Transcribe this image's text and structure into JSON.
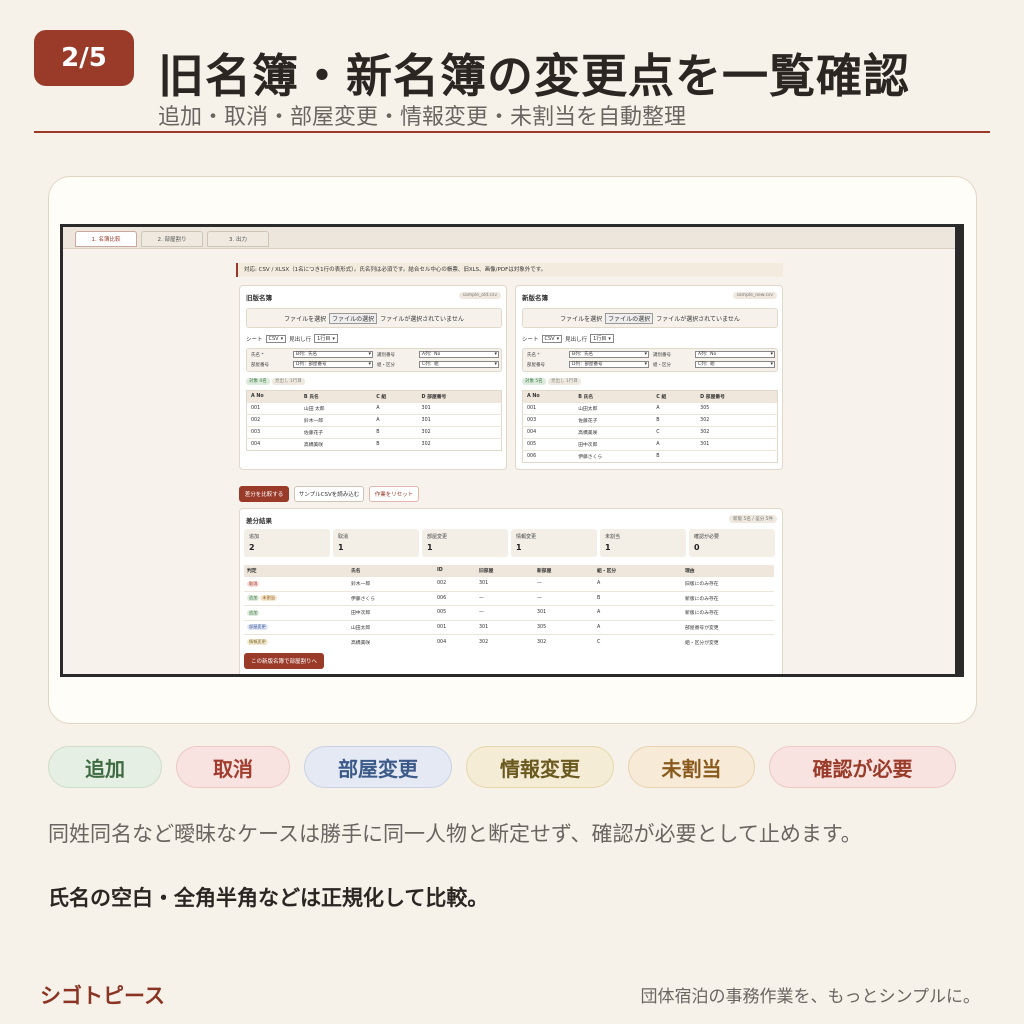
{
  "header": {
    "badge": "2/5",
    "title": "旧名簿・新名簿の変更点を一覧確認",
    "subtitle": "追加・取消・部屋変更・情報変更・未割当を自動整理"
  },
  "app": {
    "tabs": [
      {
        "label": "1. 名簿比較",
        "active": true
      },
      {
        "label": "2. 部屋割り",
        "active": false
      },
      {
        "label": "3. 出力",
        "active": false
      }
    ],
    "notice": "対応: CSV / XLSX（1名につき1行の表形式）。氏名列は必須です。結合セル中心の帳票、旧XLS、画像/PDFは対象外です。",
    "old_roster": {
      "title": "旧版名簿",
      "file_pill": "sample_old.csv",
      "drop_text": "ファイルを選択",
      "file_button": "ファイルの選択",
      "file_status": "ファイルが選択されていません",
      "sheet_label": "シート",
      "sheet_value": "CSV",
      "header_row_label": "見出し行",
      "header_row_value": "1行目",
      "map": {
        "name_label": "氏名 *",
        "name_value": "B列：氏名",
        "id_label": "識別番号",
        "id_value": "A列：No",
        "room_label": "部屋番号",
        "room_value": "D列：部屋番号",
        "class_label": "組・区分",
        "class_value": "C列：組"
      },
      "tag_count": "対象 4名",
      "tag_skip": "見出し 1行目",
      "columns": [
        "A No",
        "B 氏名",
        "C 組",
        "D 部屋番号"
      ],
      "rows": [
        [
          "001",
          "山田 太郎",
          "A",
          "301"
        ],
        [
          "002",
          "鈴木一郎",
          "A",
          "301"
        ],
        [
          "003",
          "佐藤花子",
          "B",
          "302"
        ],
        [
          "004",
          "高橋美咲",
          "B",
          "302"
        ]
      ]
    },
    "new_roster": {
      "title": "新版名簿",
      "file_pill": "sample_new.csv",
      "drop_text": "ファイルを選択",
      "file_button": "ファイルの選択",
      "file_status": "ファイルが選択されていません",
      "sheet_label": "シート",
      "sheet_value": "CSV",
      "header_row_label": "見出し行",
      "header_row_value": "1行目",
      "map": {
        "name_label": "氏名 *",
        "name_value": "B列：氏名",
        "id_label": "識別番号",
        "id_value": "A列：No",
        "room_label": "部屋番号",
        "room_value": "D列：部屋番号",
        "class_label": "組・区分",
        "class_value": "C列：組"
      },
      "tag_count": "対象 5名",
      "tag_skip": "見出し 1行目",
      "columns": [
        "A No",
        "B 氏名",
        "C 組",
        "D 部屋番号"
      ],
      "rows": [
        [
          "001",
          "山田太郎",
          "A",
          "305"
        ],
        [
          "003",
          "佐藤花子",
          "B",
          "302"
        ],
        [
          "004",
          "高橋美咲",
          "C",
          "302"
        ],
        [
          "005",
          "田中次郎",
          "A",
          "301"
        ],
        [
          "006",
          "伊藤さくら",
          "B",
          ""
        ]
      ]
    },
    "buttons": {
      "compare": "差分を比較する",
      "load_sample": "サンプルCSVを読み込む",
      "reset": "作業をリセット",
      "to_rooms": "この新版名簿で部屋割りへ"
    },
    "diff": {
      "title": "差分結果",
      "summary_pill": "新版 5名 / 差分 5件",
      "stats": [
        {
          "label": "追加",
          "value": "2"
        },
        {
          "label": "取消",
          "value": "1"
        },
        {
          "label": "部屋変更",
          "value": "1"
        },
        {
          "label": "情報変更",
          "value": "1"
        },
        {
          "label": "未割当",
          "value": "1"
        },
        {
          "label": "確認が必要",
          "value": "0"
        }
      ],
      "columns": [
        "判定",
        "氏名",
        "ID",
        "旧部屋",
        "新部屋",
        "組・区分",
        "理由"
      ],
      "rows": [
        {
          "labels": [
            {
              "text": "取消",
              "kind": "cancel"
            }
          ],
          "name": "鈴木一郎",
          "id": "002",
          "old": "301",
          "new": "—",
          "class": "A",
          "reason": "旧版にのみ存在"
        },
        {
          "labels": [
            {
              "text": "追加",
              "kind": "add"
            },
            {
              "text": "未割当",
              "kind": "unassigned"
            }
          ],
          "name": "伊藤さくら",
          "id": "006",
          "old": "—",
          "new": "—",
          "class": "B",
          "reason": "新版にのみ存在"
        },
        {
          "labels": [
            {
              "text": "追加",
              "kind": "add"
            }
          ],
          "name": "田中次郎",
          "id": "005",
          "old": "—",
          "new": "301",
          "class": "A",
          "reason": "新版にのみ存在"
        },
        {
          "labels": [
            {
              "text": "部屋変更",
              "kind": "room"
            }
          ],
          "name": "山田太郎",
          "id": "001",
          "old": "301",
          "new": "305",
          "class": "A",
          "reason": "部屋番号が変更"
        },
        {
          "labels": [
            {
              "text": "情報変更",
              "kind": "info"
            }
          ],
          "name": "高橋美咲",
          "id": "004",
          "old": "302",
          "new": "302",
          "class": "C",
          "reason": "組・区分が変更"
        }
      ]
    }
  },
  "chips": [
    {
      "label": "追加",
      "kind": "add"
    },
    {
      "label": "取消",
      "kind": "cancel"
    },
    {
      "label": "部屋変更",
      "kind": "room"
    },
    {
      "label": "情報変更",
      "kind": "info"
    },
    {
      "label": "未割当",
      "kind": "unassigned"
    },
    {
      "label": "確認が必要",
      "kind": "confirm"
    }
  ],
  "description": "同姓同名など曖昧なケースは勝手に同一人物と断定せず、確認が必要として止めます。",
  "emphasis": "氏名の空白・全角半角などは正規化して比較。",
  "footer": {
    "brand": "シゴトピース",
    "tagline": "団体宿泊の事務作業を、もっとシンプルに。"
  },
  "colors": {
    "accent": "#9a3b2a",
    "background": "#f6f2ea"
  }
}
